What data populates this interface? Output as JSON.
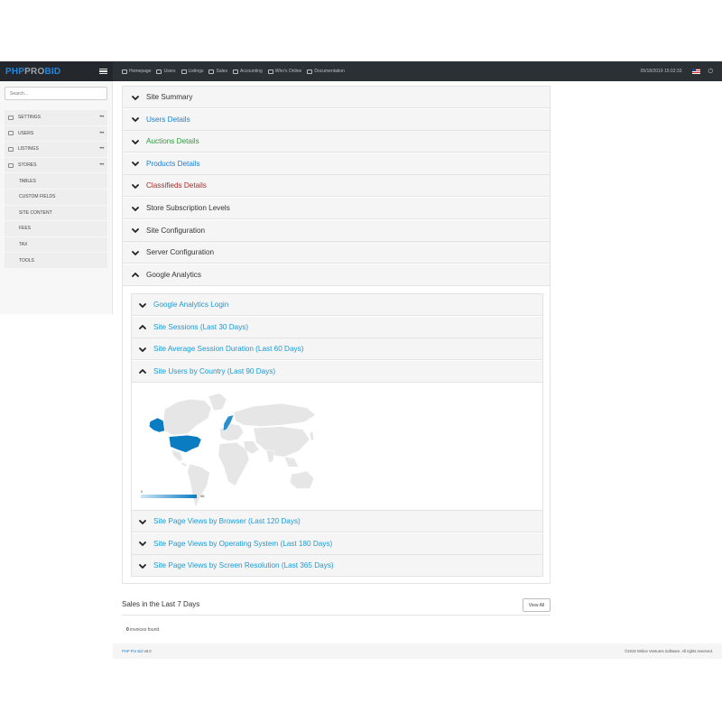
{
  "brand": {
    "part1": "PHP",
    "part2": "PRO",
    "part3": "BID",
    "color1": "#1e88e5",
    "color2": "#9aa3ad",
    "color3": "#1e88e5"
  },
  "topnav": {
    "items": [
      {
        "label": "Homepage",
        "icon": "monitor-icon"
      },
      {
        "label": "Users",
        "icon": "users-icon"
      },
      {
        "label": "Listings",
        "icon": "layers-icon"
      },
      {
        "label": "Sales",
        "icon": "calendar-icon"
      },
      {
        "label": "Accounting",
        "icon": "card-icon"
      },
      {
        "label": "Who's Online",
        "icon": "signal-icon"
      },
      {
        "label": "Documentation",
        "icon": "book-icon"
      }
    ],
    "datetime": "05/18/2019 15:02:33",
    "language_flag": "us-flag-icon",
    "power_icon": "power-icon"
  },
  "sidebar": {
    "search_placeholder": "Search...",
    "items": [
      {
        "label": "SETTINGS",
        "icon": "sliders-icon",
        "has_menu": true,
        "sub": false
      },
      {
        "label": "USERS",
        "icon": "users-icon",
        "has_menu": true,
        "sub": false
      },
      {
        "label": "LISTINGS",
        "icon": "layers-icon",
        "has_menu": true,
        "sub": false
      },
      {
        "label": "STORES",
        "icon": "cart-icon",
        "has_menu": true,
        "sub": false
      },
      {
        "label": "TABLES",
        "sub": true
      },
      {
        "label": "CUSTOM FIELDS",
        "sub": true
      },
      {
        "label": "SITE CONTENT",
        "sub": true
      },
      {
        "label": "FEES",
        "sub": true
      },
      {
        "label": "TAX",
        "sub": true
      },
      {
        "label": "TOOLS",
        "sub": true
      }
    ]
  },
  "accordion": {
    "items": [
      {
        "label": "Site Summary",
        "color": "#333333",
        "expanded": false
      },
      {
        "label": "Users Details",
        "color": "#1a7fd0",
        "expanded": false
      },
      {
        "label": "Auctions Details",
        "color": "#2e9b3c",
        "expanded": false
      },
      {
        "label": "Products Details",
        "color": "#1a7fd0",
        "expanded": false
      },
      {
        "label": "Classifieds Details",
        "color": "#a52a2a",
        "expanded": false
      },
      {
        "label": "Store Subscription Levels",
        "color": "#333333",
        "expanded": false
      },
      {
        "label": "Site Configuration",
        "color": "#333333",
        "expanded": false
      },
      {
        "label": "Server Configuration",
        "color": "#333333",
        "expanded": false
      },
      {
        "label": "Google Analytics",
        "color": "#333333",
        "expanded": true
      }
    ],
    "analytics": {
      "items": [
        {
          "label": "Google Analytics Login",
          "expanded": false
        },
        {
          "label": "Site Sessions (Last 30 Days)",
          "expanded": true
        },
        {
          "label": "Site Average Session Duration (Last 60 Days)",
          "expanded": false
        },
        {
          "label": "Site Users by Country (Last 90 Days)",
          "expanded": true
        },
        {
          "label": "Site Page Views by Browser (Last 120 Days)",
          "expanded": false
        },
        {
          "label": "Site Page Views by Operating System (Last 180 Days)",
          "expanded": false
        },
        {
          "label": "Site Page Views by Screen Resolution (Last 365 Days)",
          "expanded": false
        }
      ],
      "link_color": "#1a9ad6"
    }
  },
  "chart_data": {
    "type": "heatmap",
    "title": "",
    "regions": [
      {
        "name": "United States",
        "value": 46
      },
      {
        "name": "Canada",
        "value": 0
      },
      {
        "name": "Norway",
        "value": 10
      }
    ],
    "legend": {
      "min": "0",
      "max": "46"
    },
    "colors": {
      "low": "#cde5f5",
      "high": "#0a7cc1",
      "nodata": "#e6e6e6"
    }
  },
  "sales": {
    "title": "Sales in the Last 7 Days",
    "view_all": "View All",
    "count": "0",
    "empty_text": "invoices found."
  },
  "footer": {
    "product": "PHP Pro Bid",
    "version": "v8.0",
    "copyright": "©2019 Online Ventures Software. All rights reserved."
  }
}
